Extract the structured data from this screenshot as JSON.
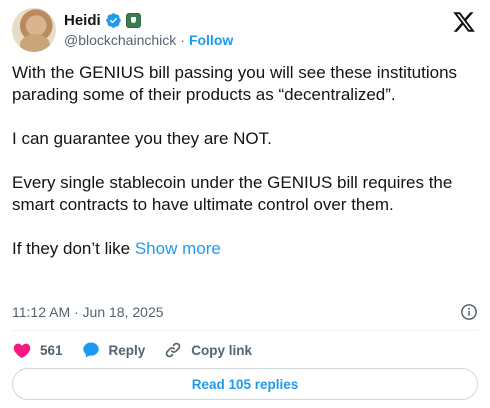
{
  "author": {
    "name": "Heidi",
    "handle": "@blockchainchick",
    "separator": "·",
    "follow_label": "Follow"
  },
  "post": {
    "paragraphs": [
      "With the GENIUS bill passing you will see these institutions parading some of their products as “decentralized”.",
      "I can guarantee you they are NOT.",
      "Every single stablecoin under the GENIUS bill requires the smart contracts to have ultimate control over them.",
      "If they don’t like "
    ],
    "show_more_label": "Show more"
  },
  "meta": {
    "timestamp": "11:12 AM · Jun 18, 2025"
  },
  "actions": {
    "like_count": "561",
    "reply_label": "Reply",
    "copy_link_label": "Copy link"
  },
  "read_replies_label": "Read 105 replies",
  "colors": {
    "accent": "#1d9bf0",
    "like": "#f91880",
    "text": "#0f1419",
    "muted": "#536471"
  },
  "icons": [
    "verified-badge-icon",
    "affiliate-badge-icon",
    "x-logo-icon",
    "info-icon",
    "heart-icon",
    "reply-bubble-icon",
    "link-icon"
  ]
}
